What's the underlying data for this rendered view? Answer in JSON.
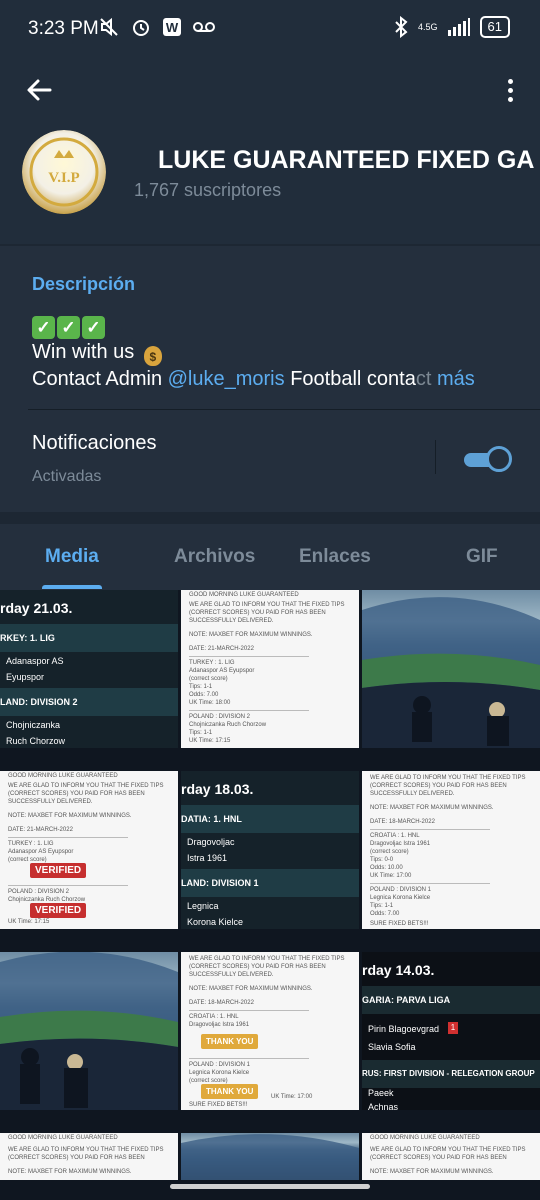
{
  "status_bar": {
    "time": "3:23 PM",
    "network": "4.5G",
    "battery": "61",
    "icons_left": [
      "mute-icon",
      "alarm-icon",
      "w-app-icon",
      "voicemail-icon"
    ],
    "icons_right": [
      "bluetooth-icon",
      "signal-icon",
      "battery-icon"
    ]
  },
  "header": {
    "title": "LUKE GUARANTEED FIXED GA",
    "subscribers": "1,767 suscriptores",
    "avatar_text": "V.I.P"
  },
  "description": {
    "label": "Descripción",
    "line1": "Win with us",
    "line2_prefix": "Contact Admin ",
    "mention": "@luke_moris",
    "line2_middle": "  Football conta",
    "line2_fade": "ct ",
    "more": "más"
  },
  "notifications": {
    "label": "Notificaciones",
    "status": "Activadas",
    "enabled": true
  },
  "tabs": [
    {
      "label": "Media",
      "active": true
    },
    {
      "label": "Archivos",
      "active": false
    },
    {
      "label": "Enlaces",
      "active": false
    },
    {
      "label": "GIF",
      "active": false
    }
  ],
  "media": {
    "c1": {
      "title": "rday 21.03.",
      "bar1": "RKEY: 1. LIG",
      "team1": "Adanaspor AS",
      "team2": "Eyupspor",
      "bar2": "LAND: DIVISION 2",
      "team3": "Chojniczanka",
      "team4": "Ruch Chorzow"
    },
    "c2": {
      "l1": "GOOD MORNING LUKE GUARANTEED",
      "l2": "WE ARE GLAD TO INFORM YOU THAT THE FIXED TIPS",
      "l3": "(CORRECT SCORES) YOU PAID FOR HAS BEEN",
      "l4": "SUCCESSFULLY DELIVERED.",
      "l5": "NOTE: MAXBET FOR MAXIMUM WINNINGS.",
      "l6": "DATE: 21-MARCH-2022",
      "l7": "TURKEY : 1. LIG",
      "l8": "Adanaspor AS  Eyupspor",
      "l9": "(correct score)",
      "l10": "Tips: 1-1",
      "l11": "Odds: 7.00",
      "l12": "UK Time: 18:00",
      "l13": "POLAND : DIVISION 2",
      "l14": "Chojniczanka  Ruch Chorzow",
      "l15": "Tips: 1-1",
      "l16": "Odds: 7.00",
      "l17": "UK Time: 17:15"
    },
    "c4": {
      "l1": "GOOD MORNING LUKE GUARANTEED",
      "l2": "WE ARE GLAD TO INFORM YOU THAT THE FIXED TIPS",
      "l3": "(CORRECT SCORES) YOU PAID FOR HAS BEEN",
      "l4": "SUCCESSFULLY DELIVERED.",
      "l5": "NOTE: MAXBET FOR MAXIMUM WINNINGS.",
      "l6": "DATE: 21-MARCH-2022",
      "l7": "TURKEY : 1. LIG",
      "l8": "Adanaspor AS  Eyupspor",
      "l9": "(correct score)",
      "l13": "POLAND : DIVISION 2",
      "l14": "Chojniczanka  Ruch Chorzow",
      "l17": "UK Time: 17:15",
      "stamp": "VERIFIED"
    },
    "c5": {
      "title": "rday 18.03.",
      "bar1": "DATIA: 1. HNL",
      "team1": "Dragovoljac",
      "team2": "Istra 1961",
      "bar2": "LAND: DIVISION 1",
      "team3": "Legnica",
      "team4": "Korona Kielce"
    },
    "c6": {
      "l2": "WE ARE GLAD TO INFORM YOU THAT THE FIXED TIPS",
      "l3": "(CORRECT SCORES) YOU PAID FOR HAS BEEN",
      "l4": "SUCCESSFULLY DELIVERED.",
      "l5": "NOTE: MAXBET FOR MAXIMUM WINNINGS.",
      "l6": "DATE: 18-MARCH-2022",
      "l7": "CROATIA : 1. HNL",
      "l8": "Dragovoljac  Istra 1961",
      "l9": "(correct score)",
      "l10": "Tips: 0-0",
      "l11": "Odds: 10.00",
      "l12": "UK Time: 17:00",
      "l13": "POLAND : DIVISION 1",
      "l14": "Legnica  Korona Kielce",
      "l15": "Tips: 1-1",
      "l16": "Odds: 7.00",
      "l17": "UK Time: 17:00",
      "l18": "SURE FIXED BETS!!!"
    },
    "c8": {
      "l2": "WE ARE GLAD TO INFORM YOU THAT THE FIXED TIPS",
      "l3": "(CORRECT SCORES) YOU PAID FOR HAS BEEN",
      "l4": "SUCCESSFULLY DELIVERED.",
      "l5": "NOTE: MAXBET FOR MAXIMUM WINNINGS.",
      "l6": "DATE: 18-MARCH-2022",
      "l7": "CROATIA : 1. HNL",
      "l8": "Dragovoljac  Istra 1961",
      "l13": "POLAND : DIVISION 1",
      "l14": "Legnica  Korona Kielce",
      "l9": "(correct score)",
      "l17": "UK Time: 17:00",
      "l18": "SURE FIXED BETS!!!",
      "stamp": "THANK YOU"
    },
    "c9": {
      "title": "rday 14.03.",
      "bar1": "GARIA: PARVA LIGA",
      "team1": "Pirin Blagoevgrad",
      "team2": "Slavia Sofia",
      "badge": "1",
      "bar2": "RUS: FIRST DIVISION - RELEGATION GROUP",
      "team3": "Paeek",
      "team4": "Achnas"
    },
    "c10": {
      "l1": "GOOD MORNING LUKE GUARANTEED",
      "l2": "WE ARE GLAD TO INFORM YOU THAT THE FIXED TIPS",
      "l3": "(CORRECT SCORES) YOU PAID FOR HAS BEEN",
      "l5": "NOTE: MAXBET FOR MAXIMUM WINNINGS."
    },
    "c12": {
      "l1": "GOOD MORNING LUKE GUARANTEED",
      "l2": "WE ARE GLAD TO INFORM YOU THAT THE FIXED TIPS",
      "l3": "(CORRECT SCORES) YOU PAID FOR HAS BEEN",
      "l5": "NOTE: MAXBET FOR MAXIMUM WINNINGS."
    }
  }
}
